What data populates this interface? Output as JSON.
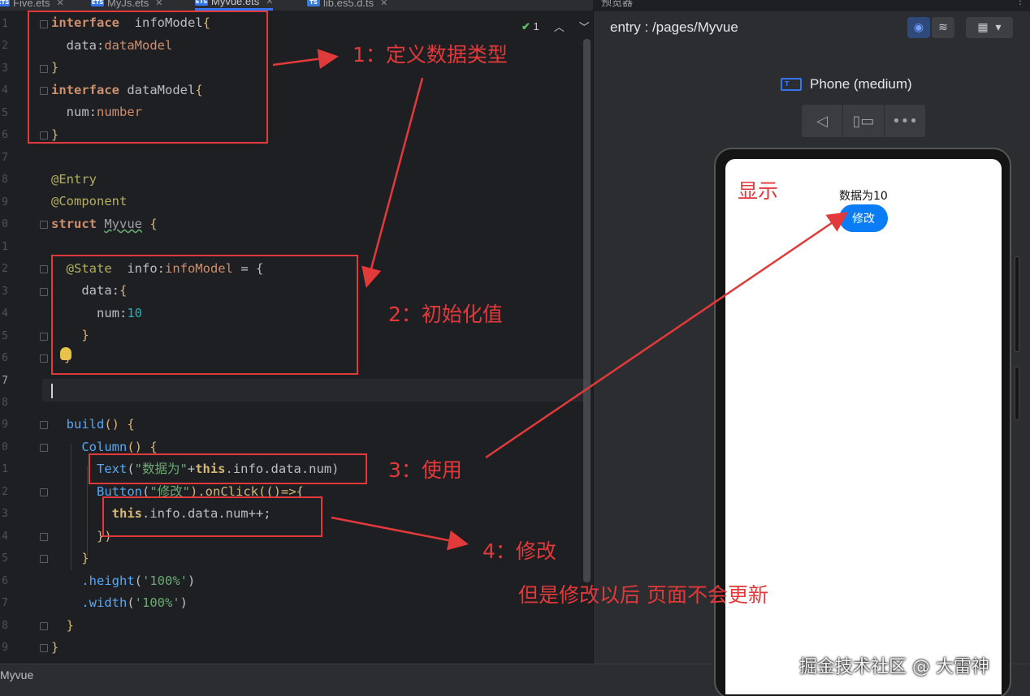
{
  "tabs": [
    {
      "label": "Five.ets",
      "icon": "ets-file-icon"
    },
    {
      "label": "MyJs.ets",
      "icon": "ets-file-icon"
    },
    {
      "label": "Myvue.ets",
      "icon": "ets-file-icon",
      "active": true
    },
    {
      "label": "lib.es5.d.ts",
      "icon": "ts-file-icon"
    }
  ],
  "preview_tab_title": "预览器",
  "editor": {
    "line_numbers": [
      "1",
      "2",
      "3",
      "4",
      "5",
      "6",
      "7",
      "8",
      "9",
      "0",
      "1",
      "2",
      "3",
      "4",
      "5",
      "6",
      "7",
      "8",
      "9",
      "0",
      "1",
      "2",
      "3",
      "4",
      "5",
      "6",
      "7",
      "8",
      "9"
    ],
    "inspection_count": "1",
    "code": {
      "l1": {
        "kw": "interface",
        "name": "  infoModel",
        "brace": "{"
      },
      "l2": {
        "prop": "  data:",
        "type": "dataModel"
      },
      "l3": "}",
      "l4": {
        "kw": "interface",
        "name": " dataModel",
        "brace": "{"
      },
      "l5": {
        "prop": "  num:",
        "type": "number"
      },
      "l6": "}",
      "l8": "@Entry",
      "l9": "@Component",
      "l10": {
        "kw": "struct",
        "name": "Myvue",
        "brace": " {"
      },
      "l12": {
        "dec": "  @State",
        "rest": "  info:",
        "type": "infoModel",
        "tail": " = {"
      },
      "l13": {
        "prop": "    data:",
        "brace": "{"
      },
      "l14": {
        "prop": "      num:",
        "num": "10"
      },
      "l15": "    }",
      "l16": "}",
      "l19": {
        "fn": "  build",
        "rest": "() {"
      },
      "l20": {
        "fn": "    Column",
        "rest": "() {"
      },
      "l21": {
        "fn": "      Text",
        "p1": "(",
        "str": "\"数据为\"",
        "plus": "+",
        "this": "this",
        "rest": ".info.data.num)"
      },
      "l22": {
        "fn": "      Button",
        "p1": "(",
        "str": "\"修改\"",
        "rest": ").onClick(()=>{"
      },
      "l23": {
        "this": "        this",
        "rest": ".info.data.num++;"
      },
      "l24": "      })",
      "l25": "    }",
      "l26": {
        "fn": "    .height",
        "p1": "(",
        "str": "'100%'",
        "p2": ")"
      },
      "l27": {
        "fn": "    .width",
        "p1": "(",
        "str": "'100%'",
        "p2": ")"
      },
      "l28": "  }",
      "l29": "}"
    }
  },
  "status": {
    "file": "Myvue"
  },
  "preview": {
    "path": "entry : /pages/Myvue",
    "device": "Phone (medium)",
    "screen_text": "数据为10",
    "screen_button": "修改",
    "toolbar_icons": [
      "inspector-icon",
      "layers-icon",
      "grid-icon",
      "chevron-down-icon"
    ],
    "device_controls": [
      "back-icon",
      "rotate-icon",
      "more-icon"
    ]
  },
  "annotations": {
    "a1": "1：定义数据类型",
    "a2": "2：初始化值",
    "a3": "3：使用",
    "a4": "4：修改",
    "note": "但是修改以后 页面不会更新",
    "display": "显示"
  },
  "watermark": "掘金技术社区 @ 大雷神",
  "colors": {
    "annotation": "#e2393b",
    "accent": "#3574f0",
    "button": "#0a7cf5"
  }
}
